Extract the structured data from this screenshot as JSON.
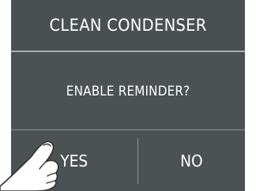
{
  "dialog": {
    "title": "CLEAN CONDENSER",
    "message": "ENABLE REMINDER?",
    "yes_label": "YES",
    "no_label": "NO"
  },
  "colors": {
    "panel_background": "#4c5253",
    "text": "#ffffff",
    "divider": "#8a9192"
  },
  "icons": {
    "pointer": "hand-pointer-icon"
  }
}
